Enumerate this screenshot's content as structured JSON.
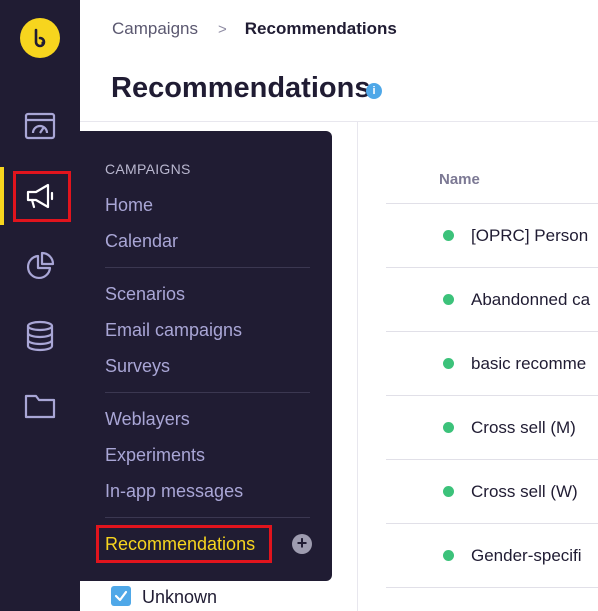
{
  "breadcrumb": {
    "parent": "Campaigns",
    "separator": ">",
    "current": "Recommendations"
  },
  "page": {
    "title": "Recommendations",
    "info_icon": "i"
  },
  "rail": {
    "items": [
      "dashboard-icon",
      "megaphone-icon",
      "pie-chart-icon",
      "database-icon",
      "folder-icon"
    ],
    "active": "megaphone-icon",
    "accent": "#f7d51e"
  },
  "flyout": {
    "section": "CAMPAIGNS",
    "groups": [
      [
        "Home",
        "Calendar"
      ],
      [
        "Scenarios",
        "Email campaigns",
        "Surveys"
      ],
      [
        "Weblayers",
        "Experiments",
        "In-app messages"
      ]
    ],
    "active_item": "Recommendations",
    "add_icon": "+"
  },
  "table": {
    "column": "Name",
    "rows": [
      {
        "name": "[OPRC] Person",
        "status": "active"
      },
      {
        "name": "Abandonned ca",
        "status": "active"
      },
      {
        "name": "basic recomme",
        "status": "active"
      },
      {
        "name": "Cross sell (M)",
        "status": "active"
      },
      {
        "name": "Cross sell (W)",
        "status": "active"
      },
      {
        "name": "Gender-specifi",
        "status": "active"
      }
    ]
  },
  "filter": {
    "checkbox_label": "Unknown",
    "checked": true
  },
  "colors": {
    "rail_bg": "#201c33",
    "active_dot": "#3cc27a",
    "highlight": "#e1141d",
    "info": "#4fa8e8"
  }
}
